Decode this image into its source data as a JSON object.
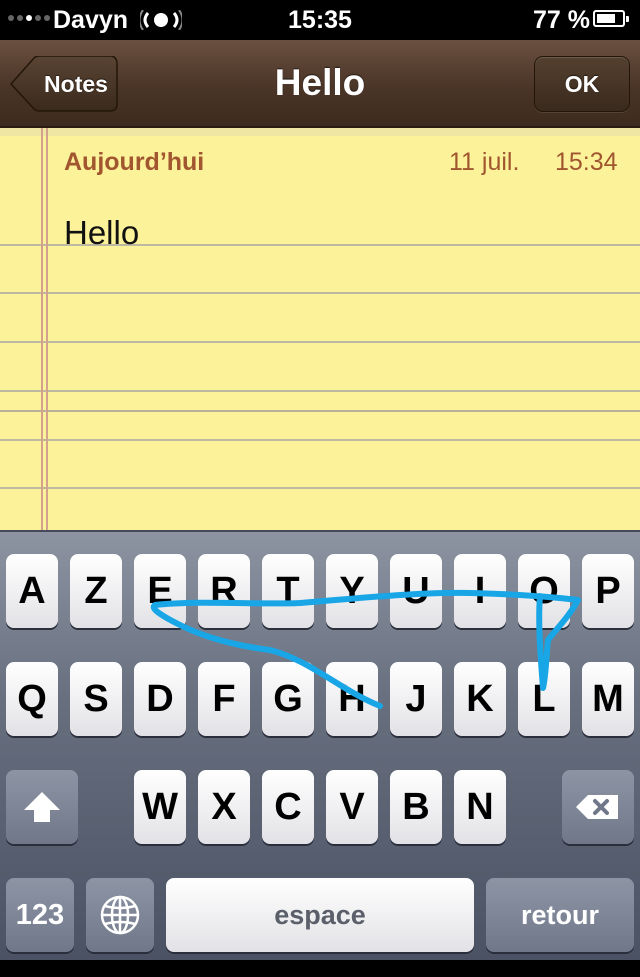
{
  "status_bar": {
    "carrier": "Davyn",
    "time": "15:35",
    "battery": "77 %"
  },
  "nav": {
    "back_label": "Notes",
    "title": "Hello",
    "ok_label": "OK"
  },
  "note": {
    "date_label": "Aujourd’hui",
    "day": "11 juil.",
    "time": "15:34",
    "body": "Hello"
  },
  "keyboard": {
    "row1": [
      "A",
      "Z",
      "E",
      "R",
      "T",
      "Y",
      "U",
      "I",
      "O",
      "P"
    ],
    "row2": [
      "Q",
      "S",
      "D",
      "F",
      "G",
      "H",
      "J",
      "K",
      "L",
      "M"
    ],
    "row3": [
      "W",
      "X",
      "C",
      "V",
      "B",
      "N"
    ],
    "num_label": "123",
    "space_label": "espace",
    "return_label": "retour"
  },
  "colors": {
    "note_paper": "#fbf29a",
    "note_meta": "#a1562f",
    "swipe_stroke": "#19a6e6"
  }
}
